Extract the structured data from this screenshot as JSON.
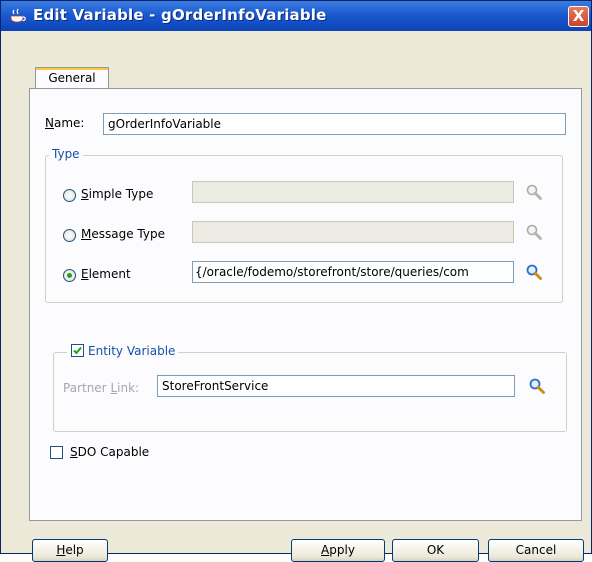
{
  "window": {
    "title": "Edit Variable - gOrderInfoVariable",
    "close_label": "X"
  },
  "tabs": [
    {
      "label": "General"
    }
  ],
  "name": {
    "label_key": "N",
    "label_rest": "ame:",
    "value": "gOrderInfoVariable"
  },
  "type_group": {
    "legend": "Type",
    "simple_type": {
      "key": "S",
      "rest": "imple Type",
      "value": ""
    },
    "message_type": {
      "key": "M",
      "rest": "essage Type",
      "value": ""
    },
    "element": {
      "key": "E",
      "rest": "lement",
      "value": "{/oracle/fodemo/storefront/store/queries/com",
      "selected": true
    }
  },
  "entity_variable": {
    "label": "Entity Variable",
    "checked": true,
    "partner_link": {
      "label_pre": "Partner ",
      "label_key": "L",
      "label_rest": "ink:",
      "value": "StoreFrontService"
    }
  },
  "sdo_capable": {
    "key": "S",
    "rest": "DO Capable",
    "checked": false
  },
  "buttons": {
    "help": {
      "key": "H",
      "rest": "elp"
    },
    "apply": {
      "key": "A",
      "rest": "pply"
    },
    "ok": "OK",
    "cancel": "Cancel"
  },
  "colors": {
    "titlebar": "#1b5ad1",
    "legend_text": "#1650a8",
    "dialog_bg": "#ece9d8",
    "tab_highlight": "#ffc83c"
  },
  "icons": [
    "coffee-cup-icon",
    "close-icon",
    "magnifier-icon",
    "checkmark-icon"
  ]
}
